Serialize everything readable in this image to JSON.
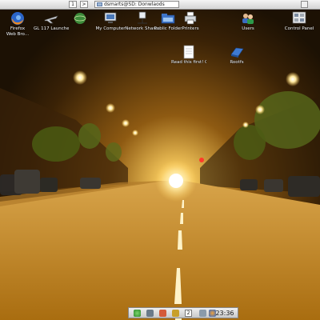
{
  "top_panel": {
    "workspace_label": "1",
    "workspace_next_label": ">",
    "task_title": "dsmarts@SD: Donwlaods"
  },
  "desktop": {
    "icons": [
      {
        "label": "Firefox\nWeb Bro..."
      },
      {
        "label": "GL 117 Launcher"
      },
      {
        "label": ""
      },
      {
        "label": "My Computer"
      },
      {
        "label": "Network Shares"
      },
      {
        "label": "Public Folder"
      },
      {
        "label": "Printers"
      },
      {
        "label": "Users"
      },
      {
        "label": "Control Panel"
      },
      {
        "label": "Read this first! Grid..."
      },
      {
        "label": "Rootfs"
      }
    ]
  },
  "bottom_panel": {
    "workspace_label": "2",
    "clock": "23:36"
  },
  "colors": {
    "panel": "#d8d8d8",
    "road": "#c48a1e",
    "light": "#fff6d0"
  }
}
